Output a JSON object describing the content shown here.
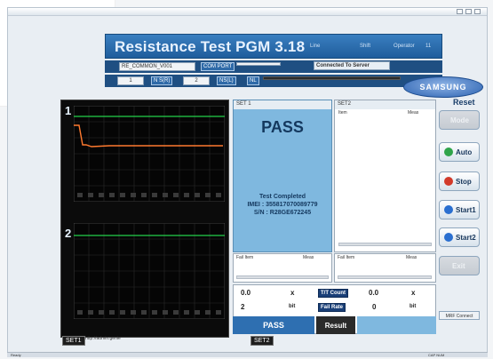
{
  "app": {
    "title": "Resistance Test PGM 3.18",
    "line_label": "Line",
    "shift_label": "Shift",
    "operator_label": "Operator",
    "operator_value": "11",
    "logo_text": "SAMSUNG",
    "reset_label": "Reset"
  },
  "config": {
    "model_value": "RE_COMMON_V001",
    "com_port_label": "COM PORT",
    "connection_status": "Connected To Server",
    "field1_value": "1",
    "nsize_label": "N S(R)",
    "field2_value": "2",
    "ns_label": "NS(L)",
    "nl_label": "NL"
  },
  "left_panel": {
    "plot1_label": "1",
    "plot2_label": "2",
    "tab_set1": "SET1",
    "status_text": "http://admin.genie"
  },
  "set1": {
    "header": "SET 1",
    "result": "PASS",
    "status_line": "Test Completed",
    "imei_line": "IMEI : 355817070089779",
    "sn_line": "S/N : R28GE672245"
  },
  "set2": {
    "header": "SET2",
    "col_item": "Item",
    "col_measure": "Meas",
    "fail_item": "Fail Item",
    "fail_meas": "Meas"
  },
  "set1_fail": {
    "fail_item": "Fail Item",
    "fail_meas": "Meas"
  },
  "counts": {
    "left_val1": "0.0",
    "left_x": "x",
    "left_val2": "2",
    "left_unit": "bit",
    "tt_count_label": "T/T Count",
    "fail_rate_label": "Fail Rate",
    "right_val1": "0.0",
    "right_x": "x",
    "right_val2": "0",
    "right_unit": "bit"
  },
  "bottom": {
    "pass_label": "PASS",
    "result_label": "Result",
    "set2_tab": "SET2"
  },
  "sidebar": {
    "mode_label": "Mode",
    "auto_label": "Auto",
    "stop_label": "Stop",
    "start1_label": "Start1",
    "start2_label": "Start2",
    "disabled_label": "Exit",
    "mrf_label": "MRF Connect"
  },
  "footer": {
    "left_text": "Ready",
    "right_text": "CAP NUM"
  },
  "colors": {
    "header_blue": "#1f5d9c",
    "pass_blue": "#7fb8df",
    "plot_line_orange": "#ff7a2f",
    "plot_limit_green": "#25d04a"
  },
  "icons": {
    "auto": "running-person-icon",
    "stop": "stop-bell-icon",
    "start1": "circle-arrow-icon",
    "start2": "circle-arrow-icon"
  }
}
